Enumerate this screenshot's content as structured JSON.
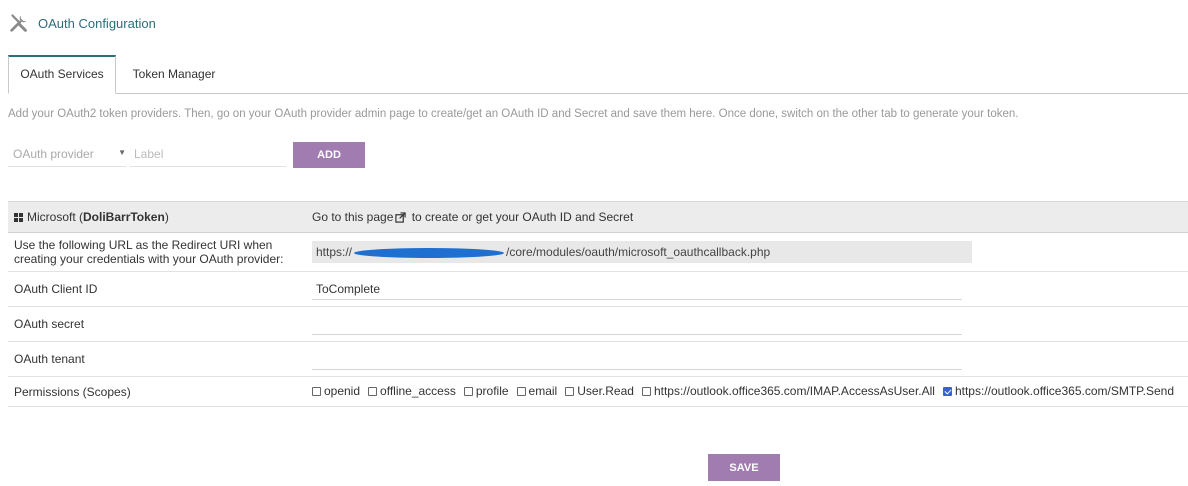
{
  "header": {
    "title": "OAuth Configuration",
    "icon": "tools-icon"
  },
  "tabs": [
    {
      "label": "OAuth Services",
      "active": true
    },
    {
      "label": "Token Manager",
      "active": false
    }
  ],
  "info_text": "Add your OAuth2 token providers. Then, go on your OAuth provider admin page to create/get an OAuth ID and Secret and save them here. Once done, switch on the other tab to generate your token.",
  "add_form": {
    "provider_placeholder": "OAuth provider",
    "label_placeholder": "Label",
    "add_button": "ADD"
  },
  "service": {
    "provider_prefix": "Microsoft (",
    "provider_name": "DoliBarrToken",
    "provider_suffix": ")",
    "go_prefix": "Go to ",
    "go_link": "this page",
    "go_suffix": " to create or get your OAuth ID and Secret",
    "redirect_label": "Use the following URL as the Redirect URI when creating your credentials with your OAuth provider:",
    "redirect_url_start": "https://",
    "redirect_url_end": "/core/modules/oauth/microsoft_oauthcallback.php",
    "client_id_label": "OAuth Client ID",
    "client_id_value": "ToComplete",
    "secret_label": "OAuth secret",
    "secret_value": "",
    "tenant_label": "OAuth tenant",
    "tenant_value": "",
    "permissions_label": "Permissions (Scopes)",
    "scopes": [
      {
        "label": "openid",
        "checked": false
      },
      {
        "label": "offline_access",
        "checked": false
      },
      {
        "label": "profile",
        "checked": false
      },
      {
        "label": "email",
        "checked": false
      },
      {
        "label": "User.Read",
        "checked": false
      },
      {
        "label": "https://outlook.office365.com/IMAP.AccessAsUser.All",
        "checked": false
      },
      {
        "label": "https://outlook.office365.com/SMTP.Send",
        "checked": true
      }
    ]
  },
  "save_button": "SAVE",
  "colors": {
    "accent": "#a07cb0",
    "title": "#2c6e7a",
    "checkbox": "#2f66d4"
  }
}
